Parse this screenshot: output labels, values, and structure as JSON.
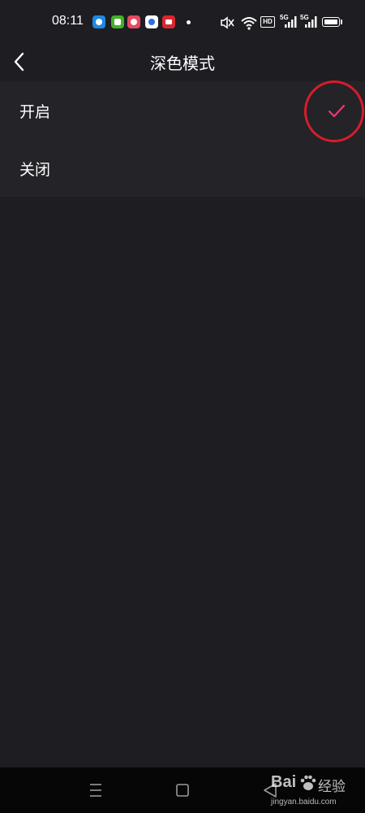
{
  "status_bar": {
    "time": "08:11",
    "notification_apps": [
      {
        "name": "app-blue-icon",
        "color": "#1e88e5"
      },
      {
        "name": "app-green-icon",
        "color": "#43b02a"
      },
      {
        "name": "app-red-icon",
        "color": "#e84a5f"
      },
      {
        "name": "app-baidu-icon",
        "color": "#2f6fde"
      },
      {
        "name": "app-news-icon",
        "color": "#d8282f"
      }
    ],
    "icons": [
      "mute-icon",
      "wifi-icon",
      "hd-icon",
      "signal-5g-icon",
      "signal-5g-icon",
      "battery-icon"
    ],
    "network_type": "5G",
    "hd_label": "HD"
  },
  "header": {
    "title": "深色模式"
  },
  "options": [
    {
      "label": "开启",
      "selected": true
    },
    {
      "label": "关闭",
      "selected": false
    }
  ],
  "colors": {
    "background": "#1d1d22",
    "option_background": "#232328",
    "accent_check": "#f0386b",
    "annotation": "#d81c2a",
    "nav_bar": "#060607"
  },
  "watermark": {
    "brand": "Bai",
    "suffix": "经验",
    "url": "jingyan.baidu.com"
  }
}
